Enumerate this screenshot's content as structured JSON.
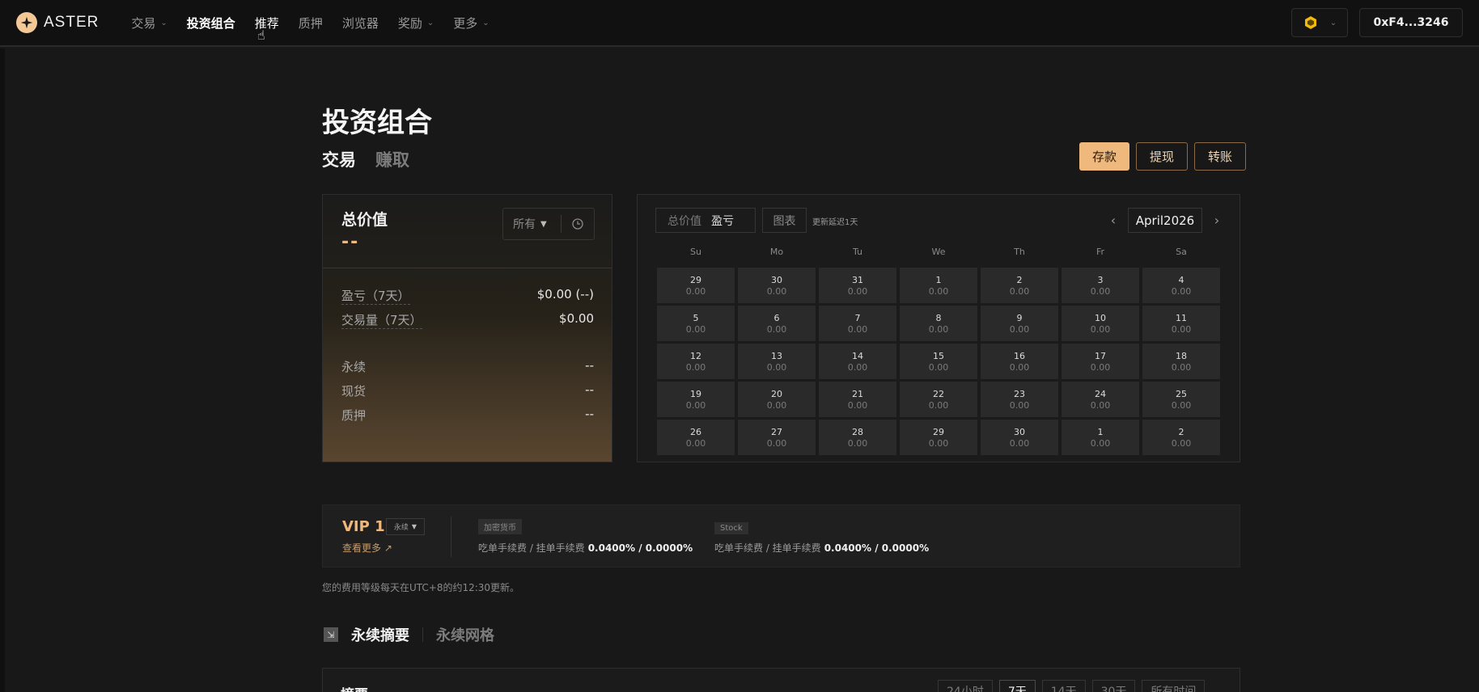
{
  "brand": {
    "name": "ASTER",
    "accent": "#efb97d"
  },
  "nav": {
    "items": [
      {
        "label": "交易",
        "dropdown": true,
        "state": "default"
      },
      {
        "label": "投资组合",
        "dropdown": false,
        "state": "active"
      },
      {
        "label": "推荐",
        "dropdown": false,
        "state": "hover"
      },
      {
        "label": "质押",
        "dropdown": false,
        "state": "default"
      },
      {
        "label": "浏览器",
        "dropdown": false,
        "state": "default"
      },
      {
        "label": "奖励",
        "dropdown": true,
        "state": "default"
      },
      {
        "label": "更多",
        "dropdown": true,
        "state": "default"
      }
    ]
  },
  "wallet": {
    "address": "0xF4...3246",
    "chain_icon": "bnb-chain-icon"
  },
  "page": {
    "title": "投资组合",
    "tabs": [
      {
        "label": "交易",
        "active": true
      },
      {
        "label": "赚取",
        "active": false
      }
    ],
    "actions": {
      "deposit": "存款",
      "withdraw": "提现",
      "transfer": "转账"
    }
  },
  "value_card": {
    "title": "总价值",
    "value": "--",
    "filter_label": "所有",
    "rows": [
      {
        "label": "盈亏（7天）",
        "value": "$0.00 (--)",
        "dashed": true
      },
      {
        "label": "交易量（7天）",
        "value": "$0.00",
        "dashed": true
      },
      {
        "label": "永续",
        "value": "--",
        "dashed": false
      },
      {
        "label": "现货",
        "value": "--",
        "dashed": false
      },
      {
        "label": "质押",
        "value": "--",
        "dashed": false
      }
    ]
  },
  "calendar": {
    "toggle": {
      "off": "总价值",
      "on": "盈亏"
    },
    "chart_label": "图表",
    "note": "更新延迟1天",
    "month": "April2026",
    "weekdays": [
      "Su",
      "Mo",
      "Tu",
      "We",
      "Th",
      "Fr",
      "Sa"
    ],
    "weeks": [
      [
        {
          "d": "29",
          "v": "0.00"
        },
        {
          "d": "30",
          "v": "0.00"
        },
        {
          "d": "31",
          "v": "0.00"
        },
        {
          "d": "1",
          "v": "0.00"
        },
        {
          "d": "2",
          "v": "0.00"
        },
        {
          "d": "3",
          "v": "0.00"
        },
        {
          "d": "4",
          "v": "0.00"
        }
      ],
      [
        {
          "d": "5",
          "v": "0.00"
        },
        {
          "d": "6",
          "v": "0.00"
        },
        {
          "d": "7",
          "v": "0.00"
        },
        {
          "d": "8",
          "v": "0.00"
        },
        {
          "d": "9",
          "v": "0.00"
        },
        {
          "d": "10",
          "v": "0.00"
        },
        {
          "d": "11",
          "v": "0.00"
        }
      ],
      [
        {
          "d": "12",
          "v": "0.00"
        },
        {
          "d": "13",
          "v": "0.00"
        },
        {
          "d": "14",
          "v": "0.00"
        },
        {
          "d": "15",
          "v": "0.00"
        },
        {
          "d": "16",
          "v": "0.00"
        },
        {
          "d": "17",
          "v": "0.00"
        },
        {
          "d": "18",
          "v": "0.00"
        }
      ],
      [
        {
          "d": "19",
          "v": "0.00"
        },
        {
          "d": "20",
          "v": "0.00"
        },
        {
          "d": "21",
          "v": "0.00"
        },
        {
          "d": "22",
          "v": "0.00"
        },
        {
          "d": "23",
          "v": "0.00"
        },
        {
          "d": "24",
          "v": "0.00"
        },
        {
          "d": "25",
          "v": "0.00"
        }
      ],
      [
        {
          "d": "26",
          "v": "0.00"
        },
        {
          "d": "27",
          "v": "0.00"
        },
        {
          "d": "28",
          "v": "0.00"
        },
        {
          "d": "29",
          "v": "0.00"
        },
        {
          "d": "30",
          "v": "0.00"
        },
        {
          "d": "1",
          "v": "0.00"
        },
        {
          "d": "2",
          "v": "0.00"
        }
      ]
    ]
  },
  "vip": {
    "level": "VIP 1",
    "market_select": "永续",
    "more_link": "查看更多 ↗",
    "groups": [
      {
        "tag": "加密货币",
        "label": "吃单手续费 / 挂单手续费",
        "rate": "0.0400% / 0.0000%"
      },
      {
        "tag": "Stock",
        "label": "吃单手续费 / 挂单手续费",
        "rate": "0.0400% / 0.0000%"
      }
    ],
    "note": "您的费用等级每天在UTC+8的约12:30更新。"
  },
  "perp": {
    "tabs": [
      {
        "label": "永续摘要",
        "active": true
      },
      {
        "label": "永续网格",
        "active": false
      }
    ]
  },
  "summary": {
    "title": "摘要",
    "ranges": [
      {
        "label": "24小时",
        "active": false
      },
      {
        "label": "7天",
        "active": true
      },
      {
        "label": "14天",
        "active": false
      },
      {
        "label": "30天",
        "active": false
      },
      {
        "label": "所有时间",
        "active": false
      }
    ]
  }
}
